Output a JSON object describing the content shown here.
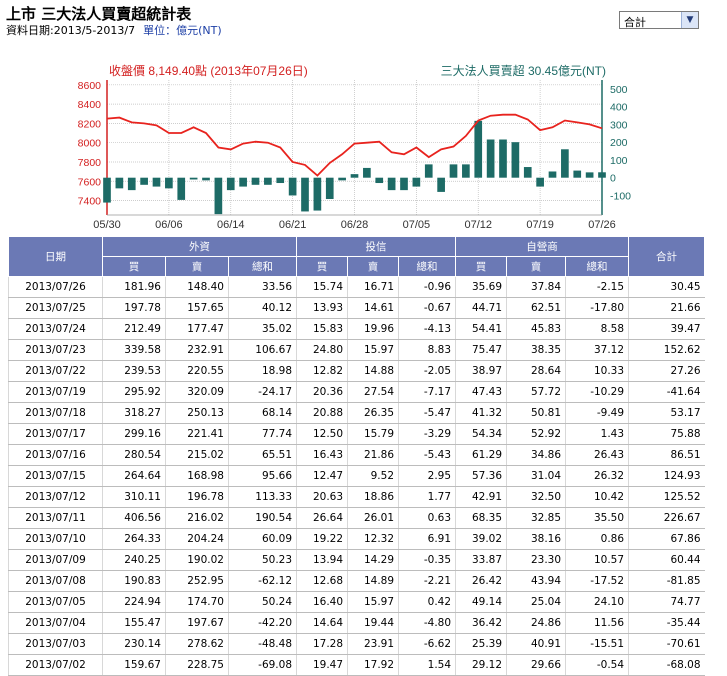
{
  "header": {
    "title": "上市 三大法人買賣超統計表",
    "period": "資料日期:2013/5-2013/7",
    "unit": "單位：億元(NT)"
  },
  "selector": {
    "value": "合計"
  },
  "chart_data": {
    "type": "line+bar",
    "left_legend": "收盤價 8,149.40點 (2013年07月26日)",
    "right_legend": "三大法人買賣超 30.45億元(NT)",
    "colors": {
      "line": "#e8231e",
      "bar": "#1d6b66",
      "left_axis": "#d32020",
      "right_axis": "#1d6b66",
      "grid": "#bdbdbd"
    },
    "y_left": {
      "min": 7250,
      "max": 8650,
      "ticks": [
        7400,
        7600,
        7800,
        8000,
        8200,
        8400,
        8600
      ]
    },
    "y_right": {
      "min": -210,
      "max": 550,
      "ticks": [
        -100,
        0,
        100,
        200,
        300,
        400,
        500
      ]
    },
    "x_tick_labels": [
      {
        "label": "05/30",
        "index": 0
      },
      {
        "label": "06/06",
        "index": 5
      },
      {
        "label": "06/14",
        "index": 10
      },
      {
        "label": "06/21",
        "index": 15
      },
      {
        "label": "06/28",
        "index": 20
      },
      {
        "label": "07/05",
        "index": 25
      },
      {
        "label": "07/12",
        "index": 30
      },
      {
        "label": "07/19",
        "index": 35
      },
      {
        "label": "07/26",
        "index": 40
      }
    ],
    "close": [
      8250,
      8260,
      8210,
      8200,
      8180,
      8100,
      8100,
      8160,
      8100,
      7950,
      7930,
      7990,
      8010,
      8000,
      7950,
      7800,
      7770,
      7660,
      7790,
      7880,
      7990,
      8000,
      8010,
      7900,
      7880,
      7950,
      7850,
      7930,
      7960,
      8070,
      8230,
      8280,
      8290,
      8290,
      8240,
      8130,
      8160,
      8230,
      8210,
      8190,
      8149.4
    ],
    "net": [
      -140,
      -60,
      -70,
      -40,
      -50,
      -60,
      -125,
      -10,
      -15,
      -205,
      -70,
      -50,
      -40,
      -40,
      -30,
      -100,
      -190,
      -185,
      -120,
      -15,
      20,
      55,
      -30,
      -70,
      -70,
      -50,
      75,
      -80,
      75,
      75,
      320,
      215,
      215,
      200,
      60,
      -50,
      35,
      160,
      40,
      30,
      30.45
    ]
  },
  "table": {
    "group_headers": [
      "日期",
      "外資",
      "投信",
      "自營商",
      "合計"
    ],
    "sub_headers": [
      "買",
      "賣",
      "總和",
      "買",
      "賣",
      "總和",
      "買",
      "賣",
      "總和"
    ],
    "rows": [
      [
        "2013/07/26",
        "181.96",
        "148.40",
        "33.56",
        "15.74",
        "16.71",
        "-0.96",
        "35.69",
        "37.84",
        "-2.15",
        "30.45"
      ],
      [
        "2013/07/25",
        "197.78",
        "157.65",
        "40.12",
        "13.93",
        "14.61",
        "-0.67",
        "44.71",
        "62.51",
        "-17.80",
        "21.66"
      ],
      [
        "2013/07/24",
        "212.49",
        "177.47",
        "35.02",
        "15.83",
        "19.96",
        "-4.13",
        "54.41",
        "45.83",
        "8.58",
        "39.47"
      ],
      [
        "2013/07/23",
        "339.58",
        "232.91",
        "106.67",
        "24.80",
        "15.97",
        "8.83",
        "75.47",
        "38.35",
        "37.12",
        "152.62"
      ],
      [
        "2013/07/22",
        "239.53",
        "220.55",
        "18.98",
        "12.82",
        "14.88",
        "-2.05",
        "38.97",
        "28.64",
        "10.33",
        "27.26"
      ],
      [
        "2013/07/19",
        "295.92",
        "320.09",
        "-24.17",
        "20.36",
        "27.54",
        "-7.17",
        "47.43",
        "57.72",
        "-10.29",
        "-41.64"
      ],
      [
        "2013/07/18",
        "318.27",
        "250.13",
        "68.14",
        "20.88",
        "26.35",
        "-5.47",
        "41.32",
        "50.81",
        "-9.49",
        "53.17"
      ],
      [
        "2013/07/17",
        "299.16",
        "221.41",
        "77.74",
        "12.50",
        "15.79",
        "-3.29",
        "54.34",
        "52.92",
        "1.43",
        "75.88"
      ],
      [
        "2013/07/16",
        "280.54",
        "215.02",
        "65.51",
        "16.43",
        "21.86",
        "-5.43",
        "61.29",
        "34.86",
        "26.43",
        "86.51"
      ],
      [
        "2013/07/15",
        "264.64",
        "168.98",
        "95.66",
        "12.47",
        "9.52",
        "2.95",
        "57.36",
        "31.04",
        "26.32",
        "124.93"
      ],
      [
        "2013/07/12",
        "310.11",
        "196.78",
        "113.33",
        "20.63",
        "18.86",
        "1.77",
        "42.91",
        "32.50",
        "10.42",
        "125.52"
      ],
      [
        "2013/07/11",
        "406.56",
        "216.02",
        "190.54",
        "26.64",
        "26.01",
        "0.63",
        "68.35",
        "32.85",
        "35.50",
        "226.67"
      ],
      [
        "2013/07/10",
        "264.33",
        "204.24",
        "60.09",
        "19.22",
        "12.32",
        "6.91",
        "39.02",
        "38.16",
        "0.86",
        "67.86"
      ],
      [
        "2013/07/09",
        "240.25",
        "190.02",
        "50.23",
        "13.94",
        "14.29",
        "-0.35",
        "33.87",
        "23.30",
        "10.57",
        "60.44"
      ],
      [
        "2013/07/08",
        "190.83",
        "252.95",
        "-62.12",
        "12.68",
        "14.89",
        "-2.21",
        "26.42",
        "43.94",
        "-17.52",
        "-81.85"
      ],
      [
        "2013/07/05",
        "224.94",
        "174.70",
        "50.24",
        "16.40",
        "15.97",
        "0.42",
        "49.14",
        "25.04",
        "24.10",
        "74.77"
      ],
      [
        "2013/07/04",
        "155.47",
        "197.67",
        "-42.20",
        "14.64",
        "19.44",
        "-4.80",
        "36.42",
        "24.86",
        "11.56",
        "-35.44"
      ],
      [
        "2013/07/03",
        "230.14",
        "278.62",
        "-48.48",
        "17.28",
        "23.91",
        "-6.62",
        "25.39",
        "40.91",
        "-15.51",
        "-70.61"
      ],
      [
        "2013/07/02",
        "159.67",
        "228.75",
        "-69.08",
        "19.47",
        "17.92",
        "1.54",
        "29.12",
        "29.66",
        "-0.54",
        "-68.08"
      ]
    ]
  }
}
